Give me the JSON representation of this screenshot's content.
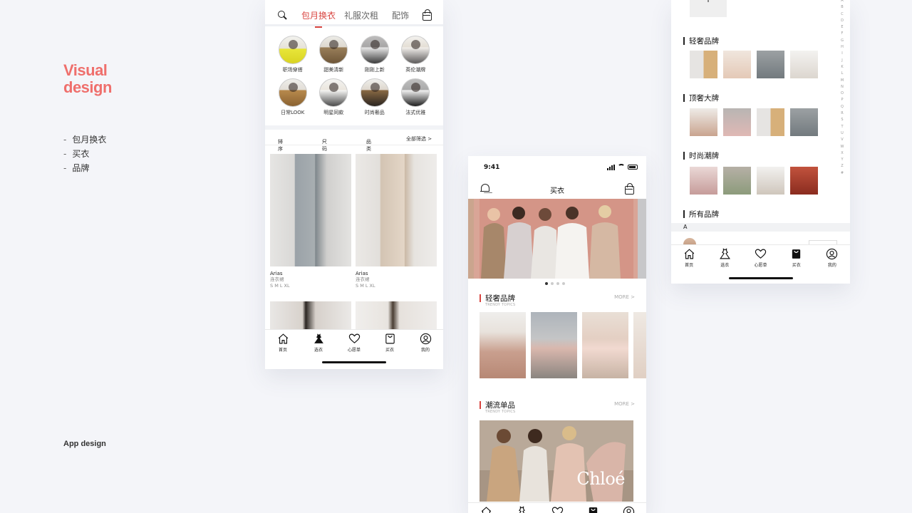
{
  "intro": {
    "title_line1": "Visual",
    "title_line2": "design",
    "list": [
      "包月换衣",
      "买衣",
      "品牌"
    ],
    "footer": "App design"
  },
  "colors": {
    "accent": "#d8443f",
    "heading": "#ef6f6c",
    "canvas": "#f4f5f9"
  },
  "tabbar_items": [
    {
      "label": "首页",
      "icon": "home-icon"
    },
    {
      "label": "选衣",
      "icon": "dress-icon"
    },
    {
      "label": "心愿单",
      "icon": "heart-icon"
    },
    {
      "label": "买衣",
      "icon": "shopping-bag-icon"
    },
    {
      "label": "我的",
      "icon": "profile-icon"
    }
  ],
  "phone1": {
    "tabs": [
      "包月换衣",
      "礼服次租",
      "配饰"
    ],
    "active_tab": "包月换衣",
    "categories": [
      "职场穿搭",
      "甜美清新",
      "刚刚上新",
      "英伦潮牌",
      "日常LOOK",
      "明星同款",
      "时尚奢品",
      "法式优雅"
    ],
    "filters": [
      "排序",
      "尺码",
      "品类",
      "全部筛选 >"
    ],
    "products": [
      {
        "brand": "Arias",
        "type": "连衣裙",
        "sizes": "S M L XL"
      },
      {
        "brand": "Arias",
        "type": "连衣裙",
        "sizes": "S M L XL"
      }
    ]
  },
  "phone2": {
    "time": "9:41",
    "title": "买衣",
    "carousel": {
      "count": 4,
      "active": 1
    },
    "sections": [
      {
        "title": "轻奢品牌",
        "subtitle": "TRENDY TOPICS",
        "more": "MORE >"
      },
      {
        "title": "潮流单品",
        "subtitle": "TRENDY TOPICS",
        "more": "MORE >"
      }
    ],
    "feature_logo": "Chloé"
  },
  "phone3": {
    "sections": [
      "轻奢品牌",
      "顶奢大牌",
      "时尚潮牌",
      "所有品牌"
    ],
    "index_letter": "A",
    "alphabet": [
      "A",
      "B",
      "C",
      "D",
      "E",
      "F",
      "G",
      "H",
      "I",
      "J",
      "K",
      "L",
      "M",
      "N",
      "O",
      "P",
      "Q",
      "R",
      "S",
      "T",
      "U",
      "V",
      "W",
      "X",
      "Y",
      "Z",
      "#"
    ]
  }
}
